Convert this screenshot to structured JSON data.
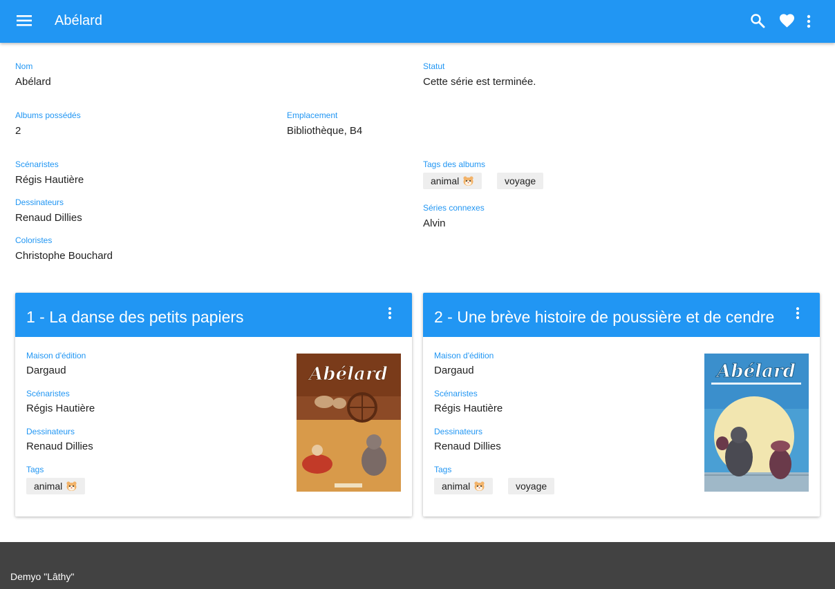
{
  "app": {
    "title": "Abélard",
    "brand_color": "#2196f3",
    "icons": {
      "menu": "menu-icon",
      "search": "search-icon",
      "favorite": "heart-icon",
      "more": "more-vert-icon"
    }
  },
  "series": {
    "nom": {
      "label": "Nom",
      "value": "Abélard"
    },
    "statut": {
      "label": "Statut",
      "value": "Cette série est terminée."
    },
    "albums": {
      "label": "Albums possédés",
      "value": "2"
    },
    "emplacement": {
      "label": "Emplacement",
      "value": "Bibliothèque, B4"
    },
    "scenaristes": {
      "label": "Scénaristes",
      "value": "Régis Hautière"
    },
    "dessinateurs": {
      "label": "Dessinateurs",
      "value": "Renaud Dillies"
    },
    "coloristes": {
      "label": "Coloristes",
      "value": "Christophe Bouchard"
    },
    "tags": {
      "label": "Tags des albums",
      "items": [
        "animal",
        "voyage"
      ]
    },
    "connexes": {
      "label": "Séries connexes",
      "value": "Alvin"
    }
  },
  "albums": [
    {
      "title": "1 - La danse des petits papiers",
      "editeur_label": "Maison d'édition",
      "editeur": "Dargaud",
      "scenaristes_label": "Scénaristes",
      "scenaristes": "Régis Hautière",
      "dessinateurs_label": "Dessinateurs",
      "dessinateurs": "Renaud Dillies",
      "tags_label": "Tags",
      "tags": [
        "animal"
      ],
      "cover_title": "Abélard"
    },
    {
      "title": "2 - Une brève histoire de poussière et de cendre",
      "editeur_label": "Maison d'édition",
      "editeur": "Dargaud",
      "scenaristes_label": "Scénaristes",
      "scenaristes": "Régis Hautière",
      "dessinateurs_label": "Dessinateurs",
      "dessinateurs": "Renaud Dillies",
      "tags_label": "Tags",
      "tags": [
        "animal",
        "voyage"
      ],
      "cover_title": "Abélard"
    }
  ],
  "footer": {
    "text": "Demyo \"Lâthy\""
  }
}
